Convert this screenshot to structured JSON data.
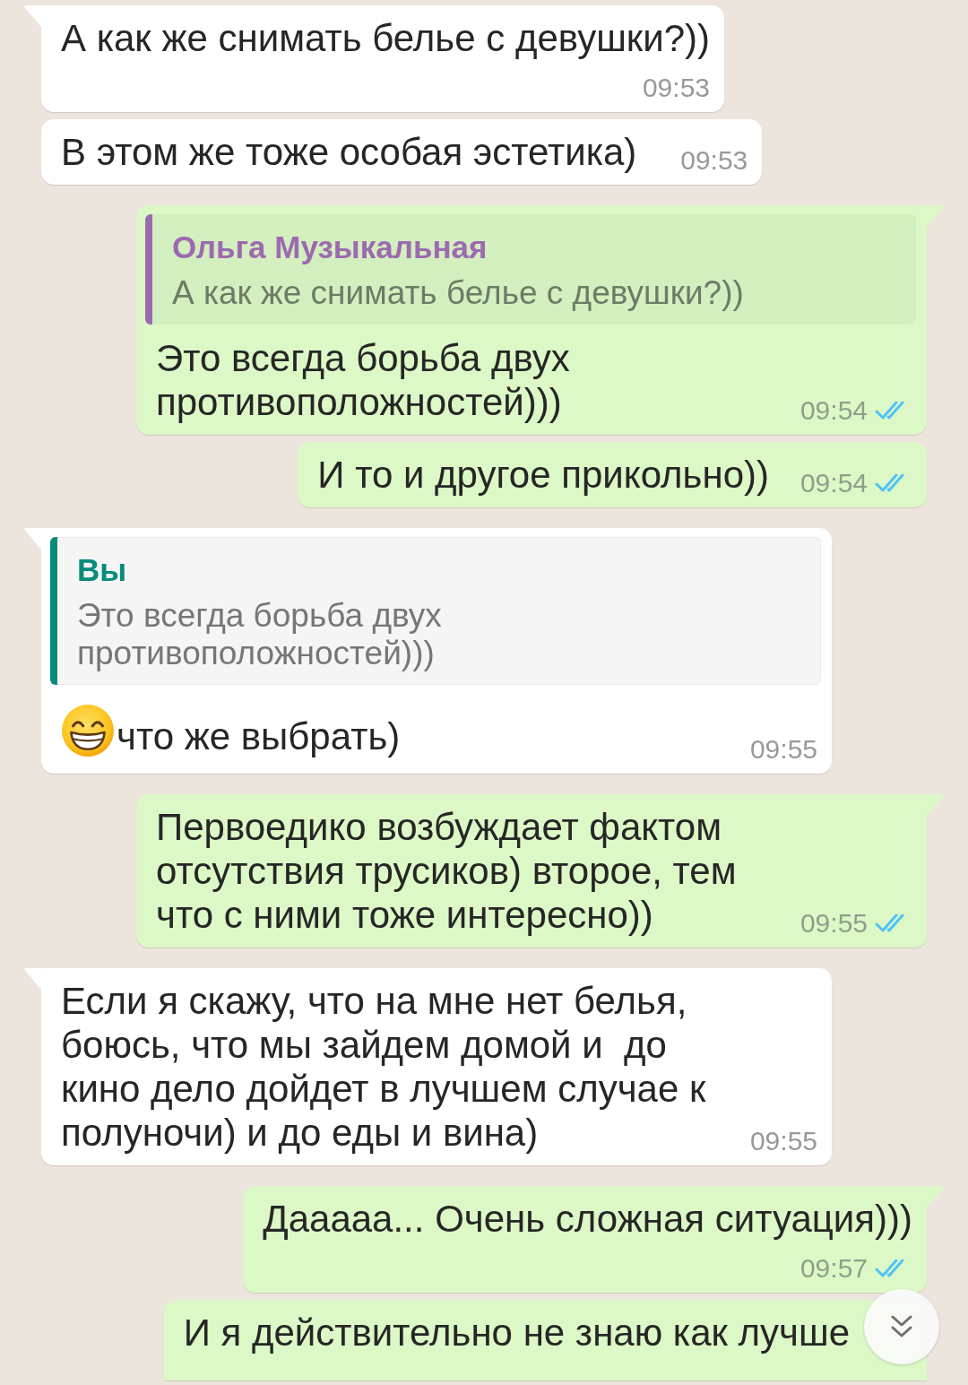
{
  "messages": [
    {
      "kind": "incoming",
      "tail": true,
      "text": "А как же снимать белье с девушки?))",
      "time": "09:53"
    },
    {
      "kind": "incoming",
      "tail": false,
      "text": "В этом же тоже особая эстетика)",
      "time": "09:53"
    },
    {
      "kind": "outgoing",
      "tail": true,
      "reply": {
        "author": "Ольга Музыкальная",
        "text": "А как же снимать белье с девушки?))",
        "color": "#9c6ab0"
      },
      "text": "Это всегда борьба двух противоположностей)))",
      "time": "09:54",
      "read": true
    },
    {
      "kind": "outgoing",
      "tail": false,
      "text": "И то и другое прикольно))",
      "time": "09:54",
      "read": true
    },
    {
      "kind": "incoming",
      "tail": true,
      "reply": {
        "author": "Вы",
        "text": "Это всегда борьба двух противоположностей)))",
        "color": "#078b7b"
      },
      "leading_emoji": true,
      "text": "что же выбрать)",
      "time": "09:55"
    },
    {
      "kind": "outgoing",
      "tail": true,
      "text": "Первоедико возбуждает фактом отсутствия трусиков) второе, тем что с ними тоже интересно))",
      "time": "09:55",
      "read": true
    },
    {
      "kind": "incoming",
      "tail": true,
      "text": "Если я скажу, что на мне нет белья, боюсь, что мы зайдем домой и  до кино дело дойдет в лучшем случае к полуночи) и до еды и вина)",
      "time": "09:55"
    },
    {
      "kind": "outgoing",
      "tail": true,
      "text": "Дааааа... Очень сложная ситуация)))",
      "time": "09:57",
      "read": true
    },
    {
      "kind": "outgoing",
      "tail": false,
      "text": "И я действительно не знаю как лучше"
    }
  ]
}
